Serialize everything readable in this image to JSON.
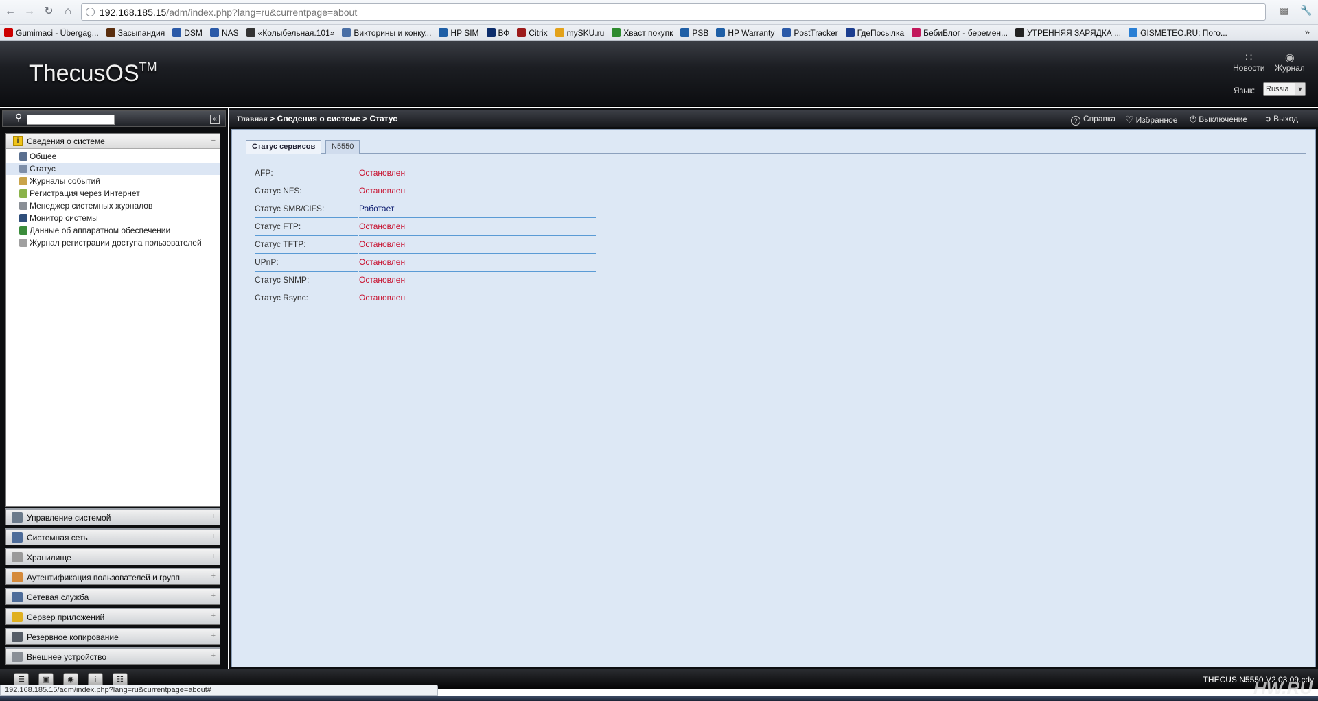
{
  "browser": {
    "url_host": "192.168.185.15",
    "url_path": "/adm/index.php?lang=ru&currentpage=about",
    "bookmarks": [
      {
        "label": "Gumimaci - Übergag...",
        "color": "#cc0000"
      },
      {
        "label": "Засыпандия",
        "color": "#5a2e0e"
      },
      {
        "label": "DSM",
        "color": "#2b5aa8"
      },
      {
        "label": "NAS",
        "color": "#2b5aa8"
      },
      {
        "label": "«Колыбельная.101»",
        "color": "#333333"
      },
      {
        "label": "Викторины и конку...",
        "color": "#4a6fa5"
      },
      {
        "label": "HP SIM",
        "color": "#1f5fa6"
      },
      {
        "label": "ВФ",
        "color": "#0c2d6b"
      },
      {
        "label": "Citrix",
        "color": "#9c1b1b"
      },
      {
        "label": "mySKU.ru",
        "color": "#e3a21a"
      },
      {
        "label": "Хваст покупк",
        "color": "#2e8b2e"
      },
      {
        "label": "PSB",
        "color": "#1f5fa6"
      },
      {
        "label": "HP Warranty",
        "color": "#1f5fa6"
      },
      {
        "label": "PostTracker",
        "color": "#2b5aa8"
      },
      {
        "label": "ГдеПосылка",
        "color": "#1b3d8f"
      },
      {
        "label": "БебиБлог - беремен...",
        "color": "#c2185b"
      },
      {
        "label": "УТРЕННЯЯ ЗАРЯДКА ...",
        "color": "#222222"
      },
      {
        "label": "GISMETEO.RU: Пого...",
        "color": "#2a7fd4"
      }
    ],
    "status_url": "192.168.185.15/adm/index.php?lang=ru&currentpage=about#"
  },
  "header": {
    "logo": "ThecusOS",
    "logo_tm": "TM",
    "news_label": "Новости",
    "journal_label": "Журнал",
    "lang_label": "Язык:",
    "lang_value": "Russia"
  },
  "sidebar": {
    "category": "Сведения о системе",
    "items": [
      {
        "label": "Общее",
        "color": "#5a6f8f",
        "selected": false
      },
      {
        "label": "Статус",
        "color": "#7d8ea8",
        "selected": true
      },
      {
        "label": "Журналы событий",
        "color": "#c9a44a",
        "selected": false
      },
      {
        "label": "Регистрация через Интернет",
        "color": "#8bb34a",
        "selected": false
      },
      {
        "label": "Менеджер системных журналов",
        "color": "#8a8f96",
        "selected": false
      },
      {
        "label": "Монитор системы",
        "color": "#2f4e7a",
        "selected": false
      },
      {
        "label": "Данные об аппаратном обеспечении",
        "color": "#3b8c3b",
        "selected": false
      },
      {
        "label": "Журнал регистрации доступа пользователей",
        "color": "#a0a0a0",
        "selected": false
      }
    ],
    "sections": [
      {
        "label": "Управление системой",
        "color": "#6b7a8a"
      },
      {
        "label": "Системная сеть",
        "color": "#4d6c99"
      },
      {
        "label": "Хранилище",
        "color": "#9a9a9a"
      },
      {
        "label": "Аутентификация пользователей и групп",
        "color": "#d58a3a"
      },
      {
        "label": "Сетевая служба",
        "color": "#4d6c99"
      },
      {
        "label": "Сервер приложений",
        "color": "#e0b020"
      },
      {
        "label": "Резервное копирование",
        "color": "#555c66"
      },
      {
        "label": "Внешнее устройство",
        "color": "#8a8f96"
      }
    ]
  },
  "breadcrumb": {
    "home": "Главная",
    "sep": ">",
    "section": "Сведения о системе",
    "page": "Статус"
  },
  "actions": {
    "help": "Справка",
    "favorites": "Избранное",
    "shutdown": "Выключение",
    "logout": "Выход"
  },
  "tabs": [
    "Статус сервисов",
    "N5550"
  ],
  "services": [
    {
      "name": "AFP:",
      "status": "Остановлен",
      "running": false
    },
    {
      "name": "Статус NFS:",
      "status": "Остановлен",
      "running": false
    },
    {
      "name": "Статус SMB/CIFS:",
      "status": "Работает",
      "running": true
    },
    {
      "name": "Статус FTP:",
      "status": "Остановлен",
      "running": false
    },
    {
      "name": "Статус TFTP:",
      "status": "Остановлен",
      "running": false
    },
    {
      "name": "UPnP:",
      "status": "Остановлен",
      "running": false
    },
    {
      "name": "Статус SNMP:",
      "status": "Остановлен",
      "running": false
    },
    {
      "name": "Статус Rsync:",
      "status": "Остановлен",
      "running": false
    }
  ],
  "footer": {
    "model": "THECUS N5550 V2.03.09.cdv",
    "watermark": "HW.RU"
  },
  "colors": {
    "stopped": "#c8102e",
    "running": "#0a1a6e",
    "content_bg": "#dde8f5"
  }
}
